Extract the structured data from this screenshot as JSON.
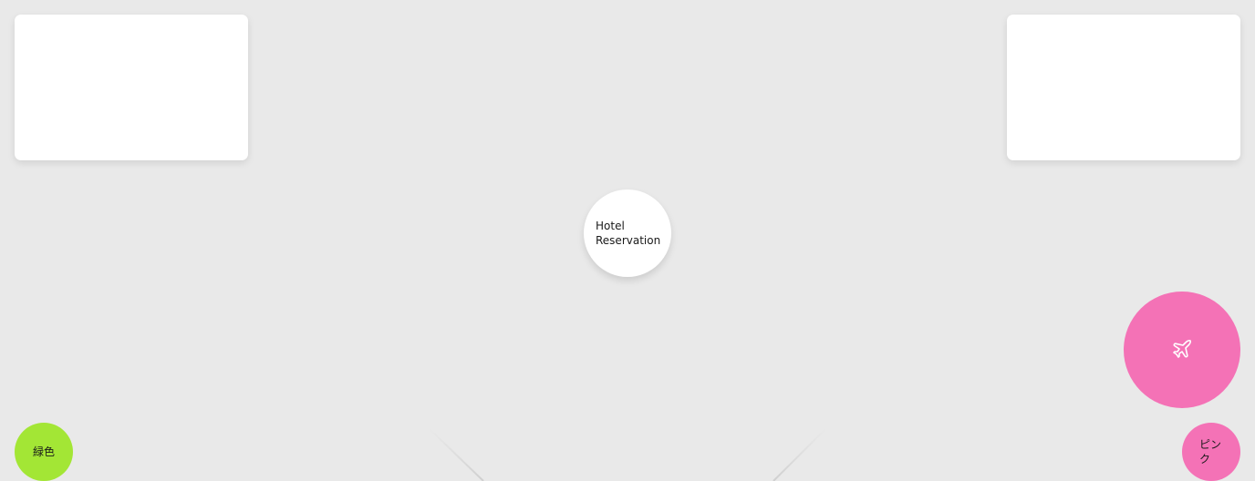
{
  "center_node": {
    "label": "Hotel\nReservation"
  },
  "fab": {
    "icon": "airplane-icon",
    "color": "#f472b6"
  },
  "swatches": [
    {
      "label": "緑色",
      "color": "#a3e635"
    },
    {
      "label": "ピンク",
      "color": "#f472b6"
    }
  ],
  "colors": {
    "background": "#e9e9e9",
    "card": "#ffffff",
    "node": "#ffffff"
  }
}
